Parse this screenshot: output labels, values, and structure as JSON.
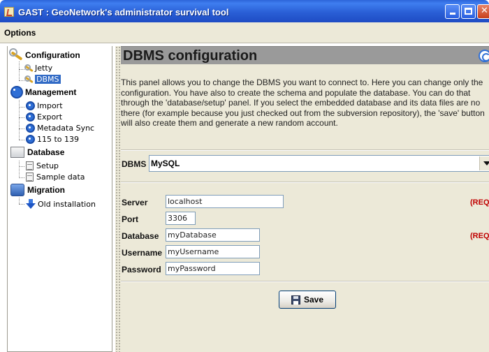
{
  "window": {
    "title": "GAST : GeoNetwork's administrator survival tool"
  },
  "menu": {
    "options": "Options"
  },
  "tree": {
    "configuration": "Configuration",
    "jetty": "Jetty",
    "dbms": "DBMS",
    "management": "Management",
    "import": "Import",
    "export": "Export",
    "metadata_sync": "Metadata Sync",
    "upgrade_115_139": "115 to 139",
    "database": "Database",
    "setup": "Setup",
    "sample_data": "Sample data",
    "migration": "Migration",
    "old_installation": "Old installation"
  },
  "panel": {
    "title": "DBMS configuration",
    "description_lines": [
      "This panel allows you to change the DBMS you want to connect to. Here you can change only the",
      "configuration. You have also to create the schema and populate the database. You can do that",
      "through the 'database/setup' panel. If you select the embedded database and its data files are no",
      "there (for example because you just checked out from the subversion repository), the 'save' button",
      "will also create them and generate a new random account."
    ]
  },
  "form": {
    "dbms_label": "DBMS",
    "dbms_value": "MySQL",
    "server_label": "Server",
    "server_value": "localhost",
    "server_required": "(REQ",
    "port_label": "Port",
    "port_value": "3306",
    "database_label": "Database",
    "database_value": "myDatabase",
    "database_required": "(REQ",
    "username_label": "Username",
    "username_value": "myUsername",
    "password_label": "Password",
    "password_value": "myPassword",
    "save_label": "Save"
  }
}
